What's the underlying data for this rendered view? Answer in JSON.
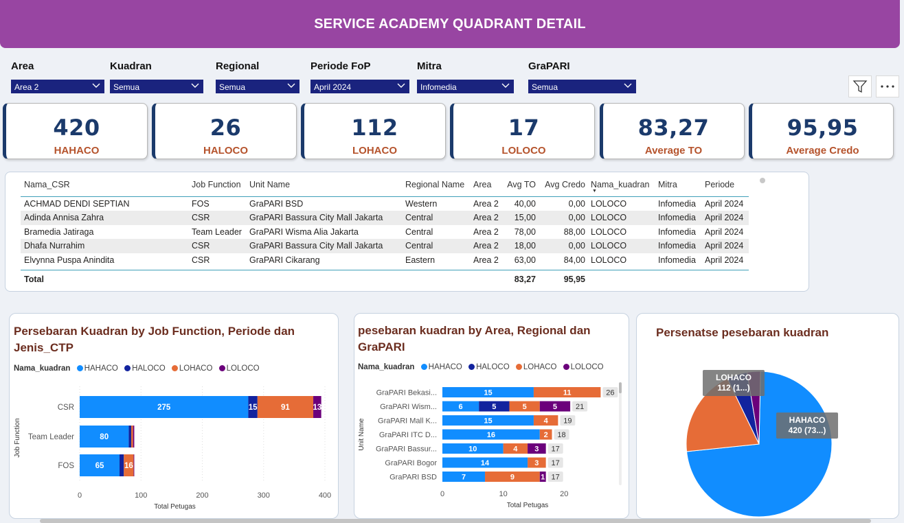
{
  "header": {
    "title": "SERVICE ACADEMY QUADRANT DETAIL"
  },
  "filters": [
    {
      "label": "Area",
      "value": "Area 2"
    },
    {
      "label": "Kuadran",
      "value": "Semua"
    },
    {
      "label": "Regional",
      "value": "Semua"
    },
    {
      "label": "Periode FoP",
      "value": "April 2024"
    },
    {
      "label": "Mitra",
      "value": "Infomedia"
    },
    {
      "label": "GraPARI",
      "value": "Semua"
    }
  ],
  "toolbar": {
    "filter_icon": "funnel-icon",
    "more_icon": "more-options-icon"
  },
  "kpis": [
    {
      "value": "420",
      "label": "HAHACO"
    },
    {
      "value": "26",
      "label": "HALOCO"
    },
    {
      "value": "112",
      "label": "LOHACO"
    },
    {
      "value": "17",
      "label": "LOLOCO"
    },
    {
      "value": "83,27",
      "label": "Average TO"
    },
    {
      "value": "95,95",
      "label": "Average Credo"
    }
  ],
  "table": {
    "columns": [
      "Nama_CSR",
      "Job Function",
      "Unit Name",
      "Regional Name",
      "Area",
      "Avg TO",
      "Avg Credo",
      "Nama_kuadran",
      "Mitra",
      "Periode"
    ],
    "rows": [
      [
        "ACHMAD DENDI SEPTIAN",
        "FOS",
        "GraPARI BSD",
        "Western",
        "Area 2",
        "40,00",
        "0,00",
        "LOLOCO",
        "Infomedia",
        "April 2024"
      ],
      [
        "Adinda Annisa Zahra",
        "CSR",
        "GraPARI Bassura City Mall Jakarta",
        "Central",
        "Area 2",
        "15,00",
        "0,00",
        "LOLOCO",
        "Infomedia",
        "April 2024"
      ],
      [
        "Bramedia Jatiraga",
        "Team Leader",
        "GraPARI Wisma Alia Jakarta",
        "Central",
        "Area 2",
        "78,00",
        "88,00",
        "LOLOCO",
        "Infomedia",
        "April 2024"
      ],
      [
        "Dhafa Nurrahim",
        "CSR",
        "GraPARI Bassura City Mall Jakarta",
        "Central",
        "Area 2",
        "18,00",
        "0,00",
        "LOLOCO",
        "Infomedia",
        "April 2024"
      ],
      [
        "Elvynna Puspa Anindita",
        "CSR",
        "GraPARI Cikarang",
        "Eastern",
        "Area 2",
        "63,00",
        "84,00",
        "LOLOCO",
        "Infomedia",
        "April 2024"
      ]
    ],
    "total": {
      "label": "Total",
      "avg_to": "83,27",
      "avg_credo": "95,95"
    }
  },
  "colors": {
    "HAHACO": "#118dff",
    "HALOCO": "#12239e",
    "LOHACO": "#e66c37",
    "LOLOCO": "#6b007b"
  },
  "legend": {
    "title": "Nama_kuadran",
    "items": [
      "HAHACO",
      "HALOCO",
      "LOHACO",
      "LOLOCO"
    ]
  },
  "chart_data": [
    {
      "type": "bar",
      "orientation": "horizontal",
      "stacked": true,
      "title": "Persebaran Kuadran by Job Function, Periode dan Jenis_CTP",
      "xlabel": "Total Petugas",
      "ylabel": "Job Function",
      "xlim": [
        0,
        400
      ],
      "xticks": [
        "0",
        "100",
        "200",
        "300",
        "400"
      ],
      "categories": [
        "CSR",
        "Team Leader",
        "FOS"
      ],
      "series": [
        {
          "name": "HAHACO",
          "values": [
            275,
            80,
            65
          ]
        },
        {
          "name": "HALOCO",
          "values": [
            15,
            4,
            7
          ]
        },
        {
          "name": "LOHACO",
          "values": [
            91,
            3,
            16
          ]
        },
        {
          "name": "LOLOCO",
          "values": [
            13,
            2,
            1
          ]
        }
      ],
      "data_labels": [
        [
          "275",
          "15",
          "91",
          "13"
        ],
        [
          "80",
          "",
          "",
          ""
        ],
        [
          "65",
          "",
          "16",
          ""
        ]
      ],
      "legend_position": "top-left"
    },
    {
      "type": "bar",
      "orientation": "horizontal",
      "stacked": true,
      "title": "pesebaran kuadran by Area, Regional dan GraPARI",
      "xlabel": "Total Petugas",
      "ylabel": "Unit Name",
      "xlim": [
        0,
        29
      ],
      "xticks": [
        "0",
        "10",
        "20"
      ],
      "categories": [
        "GraPARI Bekasi...",
        "GraPARI Wism...",
        "GraPARI Mall K...",
        "GraPARI ITC D...",
        "GraPARI Bassur...",
        "GraPARI Bogor",
        "GraPARI BSD"
      ],
      "totals": [
        26,
        21,
        19,
        18,
        17,
        17,
        17
      ],
      "series": [
        {
          "name": "HAHACO",
          "values": [
            15,
            6,
            15,
            16,
            10,
            14,
            7
          ]
        },
        {
          "name": "HALOCO",
          "values": [
            0,
            5,
            0,
            0,
            0,
            0,
            0
          ]
        },
        {
          "name": "LOHACO",
          "values": [
            11,
            5,
            4,
            2,
            4,
            3,
            9
          ]
        },
        {
          "name": "LOLOCO",
          "values": [
            0,
            5,
            0,
            0,
            3,
            0,
            1
          ]
        }
      ],
      "legend_position": "top-left"
    },
    {
      "type": "pie",
      "title": "Persenatse pesebaran kuadran",
      "slices": [
        {
          "name": "HAHACO",
          "value": 420,
          "label": "HAHACO\n420 (73...)"
        },
        {
          "name": "LOHACO",
          "value": 112,
          "label": "LOHACO\n112 (1...)"
        },
        {
          "name": "HALOCO",
          "value": 26,
          "label": ""
        },
        {
          "name": "LOLOCO",
          "value": 17,
          "label": ""
        }
      ]
    }
  ]
}
